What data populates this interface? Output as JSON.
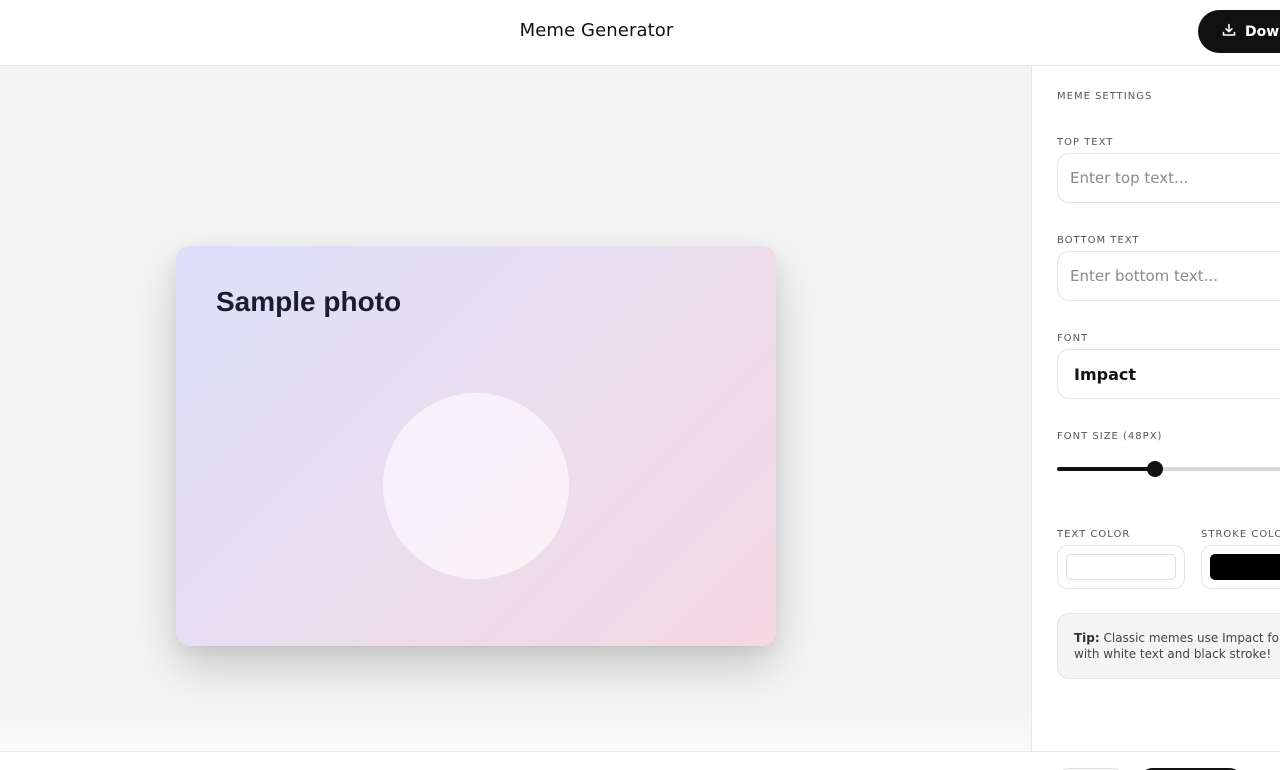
{
  "header": {
    "title": "Meme Generator",
    "download_label": "Download",
    "download_icon": "download-icon"
  },
  "canvas": {
    "photo_label": "Sample photo"
  },
  "settings": {
    "section_title": "MEME SETTINGS",
    "top_text": {
      "label": "TOP TEXT",
      "placeholder": "Enter top text...",
      "value": ""
    },
    "bottom_text": {
      "label": "BOTTOM TEXT",
      "placeholder": "Enter bottom text...",
      "value": ""
    },
    "font": {
      "label": "FONT",
      "value": "Impact"
    },
    "font_size": {
      "label": "FONT SIZE (48PX)",
      "value": 48
    },
    "text_color": {
      "label": "TEXT COLOR",
      "value": "#ffffff"
    },
    "stroke_color": {
      "label": "STROKE COLOR",
      "value": "#000000"
    },
    "tip": {
      "prefix": "Tip:",
      "text": " Classic memes use Impact font with white text and black stroke!"
    }
  },
  "colors": {
    "accent": "#111111",
    "canvas_bg": "#f4f4f4",
    "card_gradient_start": "#dcdffa",
    "card_gradient_end": "#f6d8e2"
  }
}
